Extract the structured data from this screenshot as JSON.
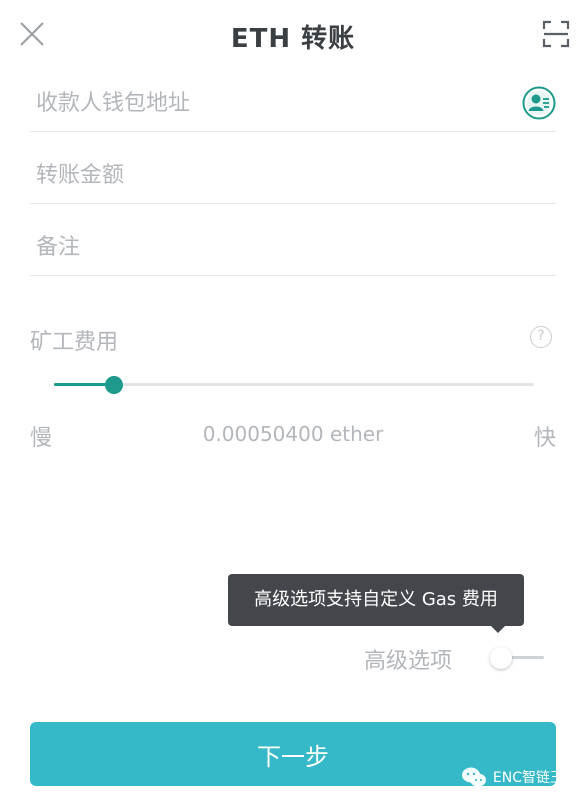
{
  "header": {
    "title": "ETH 转账"
  },
  "form": {
    "address_placeholder": "收款人钱包地址",
    "amount_placeholder": "转账金额",
    "note_placeholder": "备注"
  },
  "fee": {
    "label": "矿工费用",
    "help_symbol": "?",
    "slow_label": "慢",
    "fast_label": "快",
    "value": "0.00050400 ether",
    "slider_level": 0.125
  },
  "advanced": {
    "tooltip": "高级选项支持自定义 Gas 费用",
    "label": "高级选项",
    "enabled": false
  },
  "next_button": {
    "label": "下一步"
  },
  "watermark": {
    "text": "ENC智链王国"
  },
  "colors": {
    "accent": "#1d9a8c",
    "button": "#35b9c8",
    "placeholder": "#b3b7bb",
    "tooltip_bg": "#43474c"
  },
  "icons": {
    "close": "close-icon",
    "scan": "scan-icon",
    "contact": "contact-book-icon",
    "help": "question-icon",
    "watermark": "wechat-icon"
  }
}
